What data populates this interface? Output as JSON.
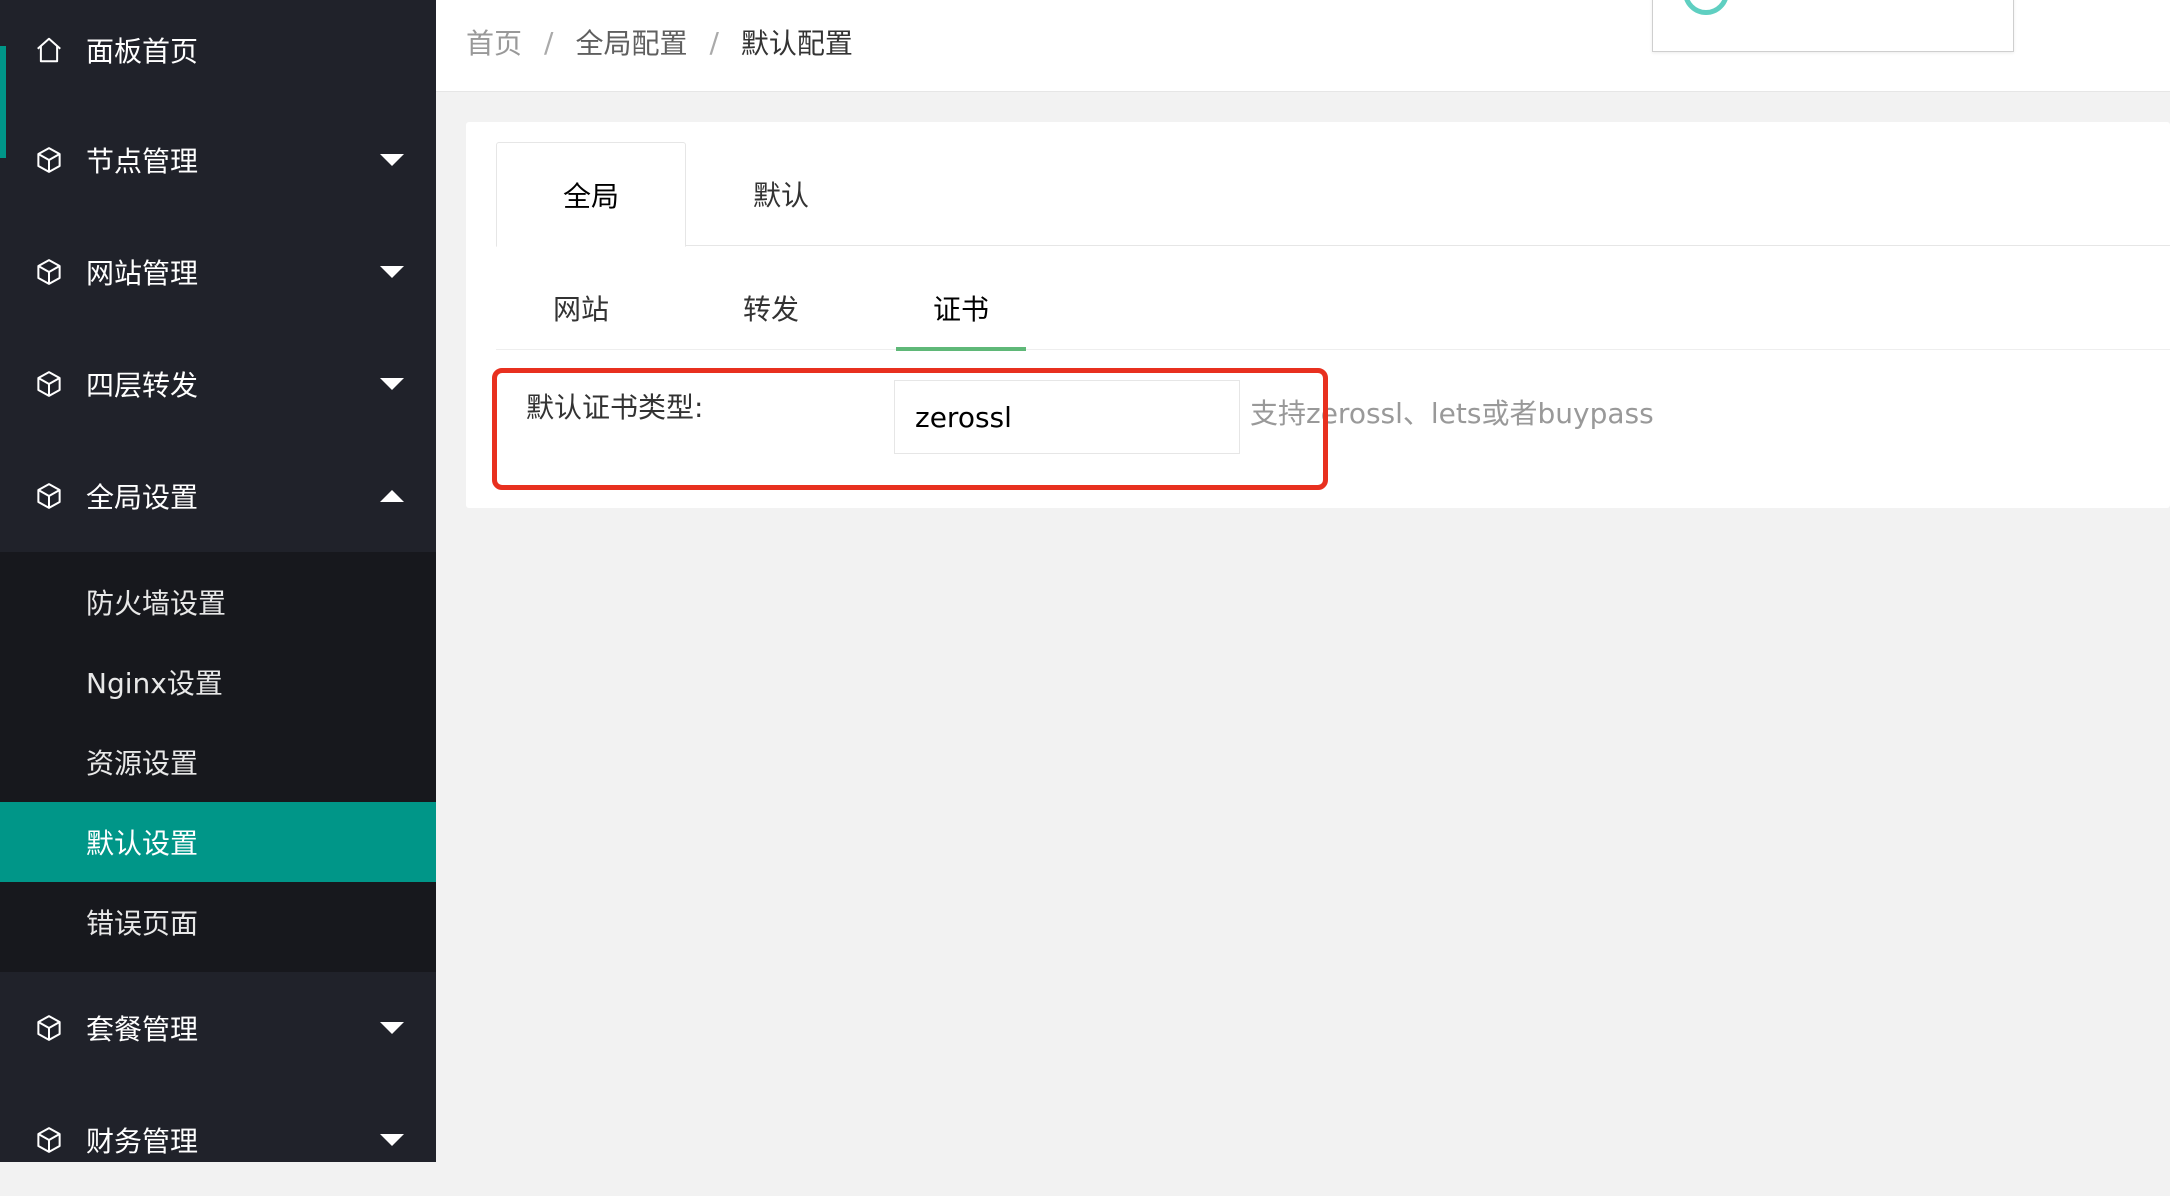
{
  "sidebar": {
    "items": [
      {
        "label": "面板首页",
        "icon": "home-icon"
      },
      {
        "label": "节点管理",
        "icon": "cube-icon",
        "arrow": "down"
      },
      {
        "label": "网站管理",
        "icon": "cube-icon",
        "arrow": "down"
      },
      {
        "label": "四层转发",
        "icon": "cube-icon",
        "arrow": "down"
      },
      {
        "label": "全局设置",
        "icon": "cube-icon",
        "arrow": "up"
      },
      {
        "label": "套餐管理",
        "icon": "cube-icon",
        "arrow": "down"
      },
      {
        "label": "财务管理",
        "icon": "cube-icon",
        "arrow": "down"
      }
    ],
    "submenu": [
      {
        "label": "防火墙设置"
      },
      {
        "label": "Nginx设置"
      },
      {
        "label": "资源设置"
      },
      {
        "label": "默认设置",
        "active": true
      },
      {
        "label": "错误页面"
      }
    ],
    "accent_color": "#009688"
  },
  "header": {
    "breadcrumb": [
      "首页",
      "全局配置",
      "默认配置"
    ],
    "separator": "/"
  },
  "tabs": {
    "top": [
      {
        "label": "全局",
        "active": true
      },
      {
        "label": "默认",
        "active": false
      }
    ],
    "sub": [
      {
        "label": "网站",
        "active": false
      },
      {
        "label": "转发",
        "active": false
      },
      {
        "label": "证书",
        "active": true
      }
    ]
  },
  "form": {
    "label": "默认证书类型:",
    "value": "zerossl",
    "hint": "支持zerossl、lets或者buypass",
    "highlight_color": "#e8301f"
  }
}
